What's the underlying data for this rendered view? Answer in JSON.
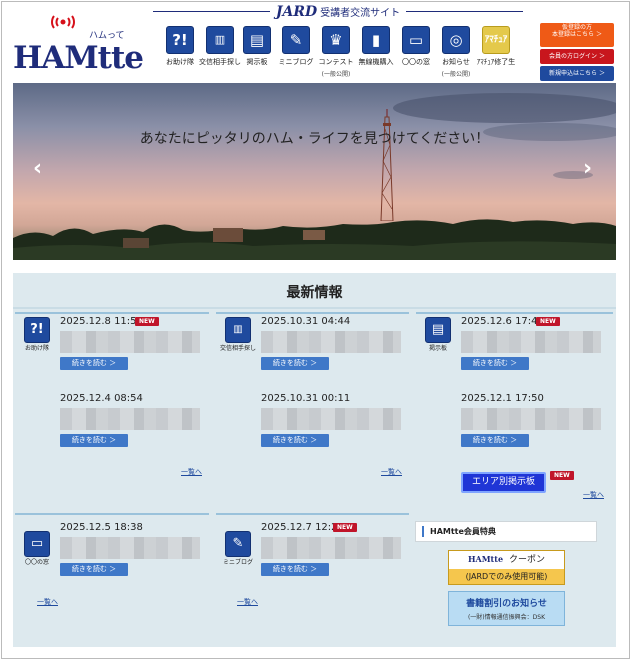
{
  "header": {
    "logo_text": "HAMtte",
    "logo_kana": "ハムって",
    "jard_brand": "JARD",
    "jard_subtitle": "受講者交流サイト"
  },
  "nav": [
    {
      "label": "お助け隊",
      "icon": "question-icon",
      "glyph": "?!"
    },
    {
      "label": "交信相手探し",
      "icon": "radio-icon",
      "glyph": "📻"
    },
    {
      "label": "掲示板",
      "icon": "board-icon",
      "glyph": "▤"
    },
    {
      "label": "ミニブログ",
      "icon": "pen-icon",
      "glyph": "✎"
    },
    {
      "label": "コンテスト",
      "icon": "trophy-icon",
      "glyph": "♛",
      "sub": "(一般公開)"
    },
    {
      "label": "無線機購入",
      "icon": "handheld-radio-icon",
      "glyph": "▮"
    },
    {
      "label": "〇〇の窓",
      "icon": "monitor-icon",
      "glyph": "▭"
    },
    {
      "label": "お知らせ",
      "icon": "broadcast-icon",
      "glyph": "◎",
      "sub": "(一般公開)"
    },
    {
      "label": "ｱﾏﾁｭｱ修了生",
      "icon": "graduate-icon",
      "glyph": "ｱﾏﾁｭｱ"
    }
  ],
  "side_buttons": {
    "provisional_1": "仮登録の方",
    "provisional_2": "本登録はこちら ＞",
    "login": "会員の方ログイン ＞",
    "signup": "新規申込はこちら ＞"
  },
  "hero": {
    "caption": "あなたにピッタリのハム・ライフを見つけてください！",
    "prev": "‹",
    "next": "›"
  },
  "news": {
    "title": "最新情報",
    "more_label": "続きを読む ＞",
    "new_label": "NEW",
    "list_link": "一覧へ",
    "sections": [
      {
        "label": "お助け隊",
        "icon": "question-icon",
        "glyph": "?!",
        "items": [
          {
            "date": "2025.12.8 11:51",
            "new": true
          },
          {
            "date": "2025.12.4 08:54",
            "new": false
          }
        ]
      },
      {
        "label": "交信相手探し",
        "icon": "radio-icon",
        "glyph": "📻",
        "items": [
          {
            "date": "2025.10.31 04:44",
            "new": false
          },
          {
            "date": "2025.10.31 00:11",
            "new": false
          }
        ]
      },
      {
        "label": "掲示板",
        "icon": "board-icon",
        "glyph": "▤",
        "items": [
          {
            "date": "2025.12.6 17:47",
            "new": true
          },
          {
            "date": "2025.12.1 17:50",
            "new": false
          }
        ]
      },
      {
        "label": "〇〇の窓",
        "icon": "monitor-icon",
        "glyph": "▭",
        "items": [
          {
            "date": "2025.12.5 18:38",
            "new": false
          }
        ]
      },
      {
        "label": "ミニブログ",
        "icon": "pen-icon",
        "glyph": "✎",
        "items": [
          {
            "date": "2025.12.7 12:20",
            "new": true
          }
        ]
      }
    ],
    "area_board": "エリア別掲示板",
    "area_new": "NEW"
  },
  "perks": {
    "title": "HAMtte会員特典",
    "coupon_brand": "HAMtte",
    "coupon_label": "クーポン",
    "coupon_note": "(JARDでのみ使用可能)",
    "books_title": "書籍割引のお知らせ",
    "books_note": "(一財)情報通信振興会：DSK"
  }
}
